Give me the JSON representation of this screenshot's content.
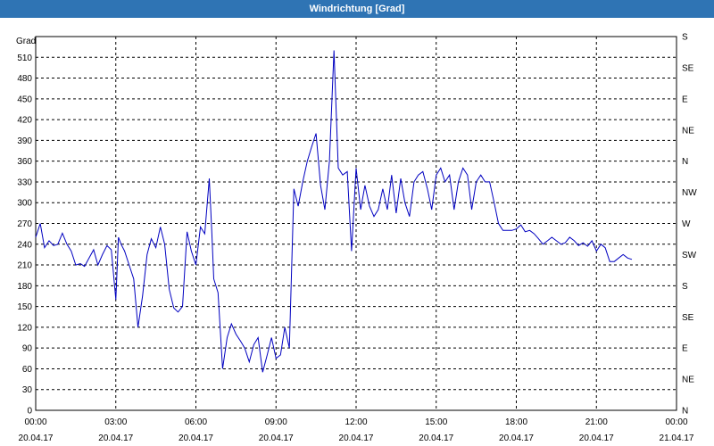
{
  "title": "Windrichtung [Grad]",
  "chart_data": {
    "type": "line",
    "ylabel": "Grad",
    "ylim": [
      0,
      540
    ],
    "y_ticks": [
      0,
      30,
      60,
      90,
      120,
      150,
      180,
      210,
      240,
      270,
      300,
      330,
      360,
      390,
      420,
      450,
      480,
      510
    ],
    "right_axis_labels": [
      "N",
      "NE",
      "E",
      "SE",
      "S",
      "SW",
      "W",
      "NW",
      "N",
      "NE",
      "E",
      "SE",
      "S"
    ],
    "x_ticks": [
      {
        "time": "00:00",
        "date": "20.04.17"
      },
      {
        "time": "03:00",
        "date": "20.04.17"
      },
      {
        "time": "06:00",
        "date": "20.04.17"
      },
      {
        "time": "09:00",
        "date": "20.04.17"
      },
      {
        "time": "12:00",
        "date": "20.04.17"
      },
      {
        "time": "15:00",
        "date": "20.04.17"
      },
      {
        "time": "18:00",
        "date": "20.04.17"
      },
      {
        "time": "21:00",
        "date": "20.04.17"
      },
      {
        "time": "00:00",
        "date": "21.04.17"
      }
    ],
    "xlim_hours": [
      0,
      24
    ],
    "grid": true,
    "line_color": "#0000c0",
    "series": [
      {
        "x_hours": [
          0.0,
          0.17,
          0.33,
          0.5,
          0.67,
          0.83,
          1.0,
          1.17,
          1.33,
          1.5,
          1.67,
          1.83,
          2.0,
          2.17,
          2.33,
          2.5,
          2.67,
          2.83,
          3.0,
          3.1,
          3.2,
          3.33,
          3.5,
          3.67,
          3.83,
          4.0,
          4.17,
          4.33,
          4.5,
          4.67,
          4.83,
          5.0,
          5.17,
          5.33,
          5.5,
          5.67,
          5.83,
          6.0,
          6.17,
          6.33,
          6.5,
          6.6,
          6.67,
          6.83,
          7.0,
          7.17,
          7.33,
          7.5,
          7.67,
          7.83,
          8.0,
          8.17,
          8.33,
          8.5,
          8.67,
          8.83,
          9.0,
          9.17,
          9.33,
          9.5,
          9.67,
          9.83,
          10.0,
          10.17,
          10.33,
          10.5,
          10.67,
          10.83,
          11.0,
          11.17,
          11.33,
          11.5,
          11.67,
          11.83,
          12.0,
          12.17,
          12.33,
          12.5,
          12.67,
          12.83,
          13.0,
          13.17,
          13.33,
          13.5,
          13.67,
          13.83,
          14.0,
          14.17,
          14.33,
          14.5,
          14.67,
          14.83,
          15.0,
          15.17,
          15.33,
          15.5,
          15.67,
          15.83,
          16.0,
          16.17,
          16.33,
          16.5,
          16.67,
          16.83,
          17.0,
          17.17,
          17.33,
          17.5,
          17.67,
          17.83,
          18.0,
          18.17,
          18.33,
          18.5,
          18.67,
          18.83,
          19.0,
          19.17,
          19.33,
          19.5,
          19.67,
          19.83,
          20.0,
          20.17,
          20.33,
          20.5,
          20.67,
          20.83,
          21.0,
          21.17,
          21.33,
          21.5,
          21.67,
          21.83,
          22.0,
          22.17,
          22.33,
          22.5,
          22.67,
          22.83,
          23.0,
          23.17,
          23.33,
          23.5,
          23.67,
          23.83,
          24.0
        ],
        "values": [
          250,
          270,
          235,
          245,
          238,
          240,
          256,
          240,
          230,
          210,
          212,
          208,
          220,
          232,
          210,
          225,
          238,
          232,
          160,
          250,
          240,
          230,
          210,
          190,
          120,
          165,
          225,
          248,
          235,
          265,
          240,
          175,
          148,
          142,
          150,
          258,
          230,
          210,
          265,
          255,
          335,
          255,
          190,
          170,
          60,
          105,
          125,
          110,
          100,
          90,
          70,
          95,
          105,
          55,
          80,
          105,
          75,
          80,
          120,
          90,
          320,
          295,
          330,
          360,
          380,
          400,
          325,
          290,
          360,
          520,
          350,
          340,
          345,
          230,
          350,
          290,
          325,
          295,
          280,
          290,
          320,
          290,
          340,
          285,
          335,
          300,
          280,
          330,
          340,
          345,
          320,
          290,
          340,
          350,
          330,
          340,
          290,
          330,
          350,
          340,
          290,
          330,
          340,
          330,
          330,
          300,
          270,
          260,
          260,
          260,
          262,
          268,
          258,
          260,
          255,
          248,
          240,
          245,
          250,
          245,
          240,
          242,
          250,
          245,
          238,
          242,
          237,
          245,
          230,
          240,
          235,
          215,
          215,
          220,
          225,
          220,
          218
        ]
      }
    ]
  }
}
